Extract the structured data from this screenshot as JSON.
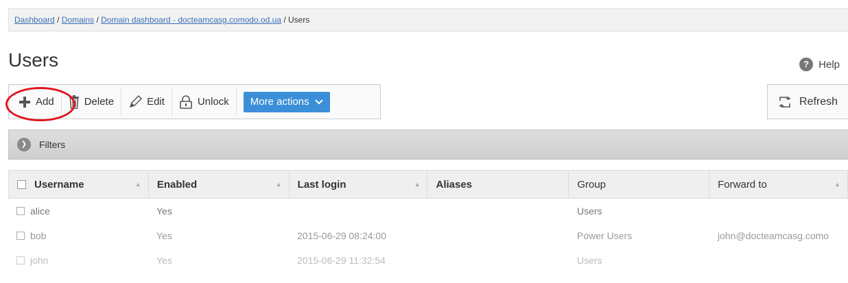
{
  "breadcrumb": {
    "dashboard": "Dashboard",
    "domains": "Domains",
    "domain_dashboard": "Domain dashboard - docteamcasg.comodo.od.ua",
    "separator": "/",
    "current": "Users"
  },
  "page": {
    "title": "Users"
  },
  "help": {
    "label": "Help",
    "icon_glyph": "?"
  },
  "toolbar": {
    "add": "Add",
    "delete": "Delete",
    "edit": "Edit",
    "unlock": "Unlock",
    "more_actions": "More actions",
    "more_actions_chevron": "❯"
  },
  "refresh": {
    "label": "Refresh"
  },
  "filters": {
    "label": "Filters",
    "arrow_glyph": "❯"
  },
  "table": {
    "columns": [
      "Username",
      "Enabled",
      "Last login",
      "Aliases",
      "Group",
      "Forward to"
    ],
    "sort_glyph": "▲",
    "rows": [
      {
        "username": "alice",
        "enabled": "Yes",
        "last_login": "",
        "aliases": "",
        "group": "Users",
        "forward_to": ""
      },
      {
        "username": "bob",
        "enabled": "Yes",
        "last_login": "2015-06-29 08:24:00",
        "aliases": "",
        "group": "Power Users",
        "forward_to": "john@docteamcasg.como"
      },
      {
        "username": "john",
        "enabled": "Yes",
        "last_login": "2015-06-29 11:32:54",
        "aliases": "",
        "group": "Users",
        "forward_to": ""
      }
    ]
  },
  "colors": {
    "link": "#3a6fb5",
    "primary_button": "#3b8fd8",
    "highlight_ring": "#e0141e"
  }
}
